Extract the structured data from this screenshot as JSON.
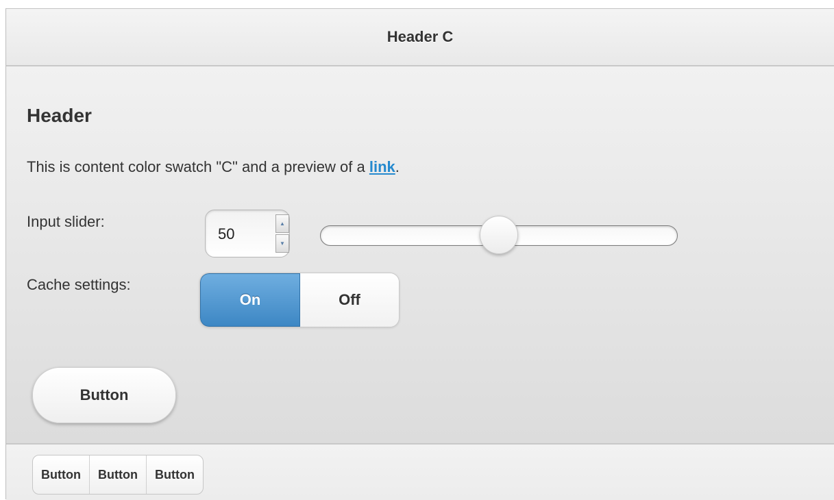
{
  "header": {
    "title": "Header C"
  },
  "content": {
    "heading": "Header",
    "text_before_link": "This is content color swatch \"C\" and a preview of a ",
    "link_label": "link",
    "text_after_link": ".",
    "slider": {
      "label": "Input slider:",
      "value": "50",
      "min": 0,
      "max": 100,
      "spinner_up_icon": "triangle-up-icon",
      "spinner_down_icon": "triangle-down-icon"
    },
    "cache": {
      "label": "Cache settings:",
      "on_label": "On",
      "off_label": "Off",
      "selected": "On"
    },
    "button_label": "Button"
  },
  "footer": {
    "buttons": [
      "Button",
      "Button",
      "Button"
    ]
  },
  "colors": {
    "accent": "#3d87c4",
    "link": "#2489ce"
  }
}
